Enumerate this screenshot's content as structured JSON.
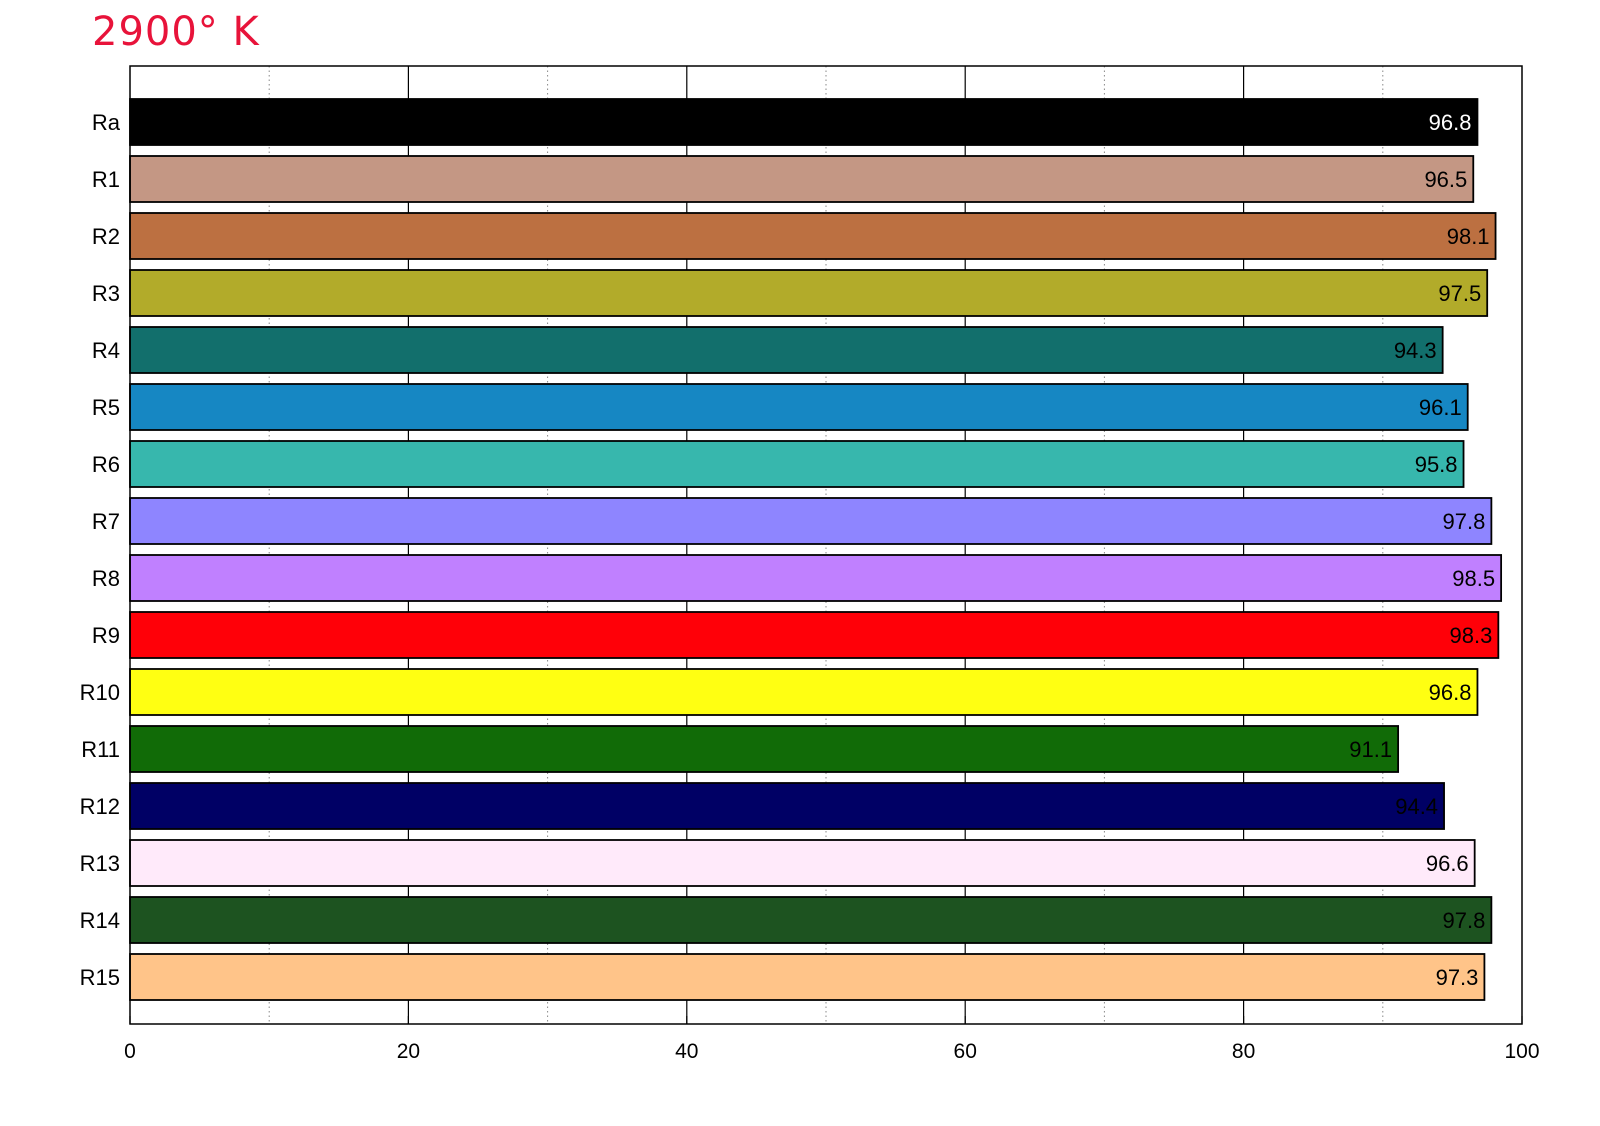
{
  "chart_data": {
    "type": "bar",
    "orientation": "horizontal",
    "title": "2900° K",
    "title_color": "#e8133a",
    "categories": [
      "Ra",
      "R1",
      "R2",
      "R3",
      "R4",
      "R5",
      "R6",
      "R7",
      "R8",
      "R9",
      "R10",
      "R11",
      "R12",
      "R13",
      "R14",
      "R15"
    ],
    "values": [
      96.8,
      96.5,
      98.1,
      97.5,
      94.3,
      96.1,
      95.8,
      97.8,
      98.5,
      98.3,
      96.8,
      91.1,
      94.4,
      96.6,
      97.8,
      97.3
    ],
    "value_labels": [
      "96.8",
      "96.5",
      "98.1",
      "97.5",
      "94.3",
      "96.1",
      "95.8",
      "97.8",
      "98.5",
      "98.3",
      "96.8",
      "91.1",
      "94.4",
      "96.6",
      "97.8",
      "97.3"
    ],
    "colors": [
      "#000000",
      "#c49784",
      "#bc7041",
      "#b2ab2a",
      "#126f6c",
      "#1687c3",
      "#37b7ad",
      "#8e85ff",
      "#c080ff",
      "#ff0008",
      "#ffff12",
      "#116b07",
      "#000065",
      "#ffeafa",
      "#1d5320",
      "#ffc489"
    ],
    "label_colors": [
      "#ffffff",
      "#000000",
      "#000000",
      "#000000",
      "#000000",
      "#000000",
      "#000000",
      "#000000",
      "#000000",
      "#000000",
      "#000000",
      "#000000",
      "#000000",
      "#000000",
      "#000000",
      "#000000"
    ],
    "xlim": [
      0,
      100
    ],
    "xticks": [
      "0",
      "20",
      "40",
      "60",
      "80",
      "100"
    ],
    "major_tick_values": [
      0,
      20,
      40,
      60,
      80,
      100
    ],
    "minor_grid_values": [
      10,
      30,
      50,
      70,
      90
    ],
    "xlabel": "",
    "ylabel": "",
    "grid": true
  }
}
